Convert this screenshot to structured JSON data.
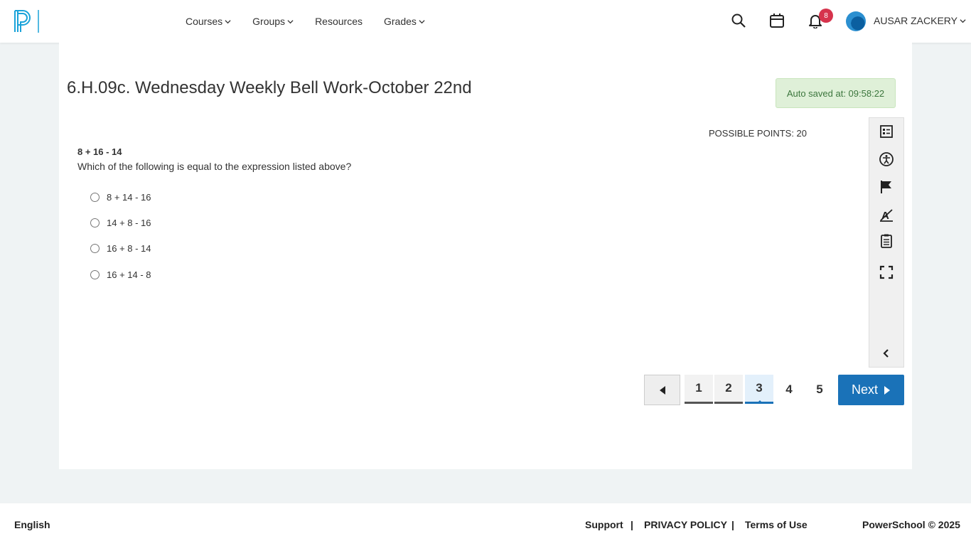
{
  "header": {
    "nav": [
      {
        "label": "Courses",
        "has_dropdown": true
      },
      {
        "label": "Groups",
        "has_dropdown": true
      },
      {
        "label": "Resources",
        "has_dropdown": false
      },
      {
        "label": "Grades",
        "has_dropdown": true
      }
    ],
    "icons": [
      "search-icon",
      "calendar-icon",
      "bell-icon"
    ],
    "notification_count": "8",
    "user_name": "AUSAR ZACKERY"
  },
  "assessment": {
    "title": "6.H.09c. Wednesday Weekly Bell Work-October 22nd",
    "autosave": "Auto saved at: 09:58:22",
    "possible_points": "POSSIBLE POINTS: 20",
    "question_expression": "8 + 16 - 14",
    "question_text": "Which of the following is equal to the expression listed above?",
    "options": [
      "8 + 14 - 16",
      "14 + 8 - 16",
      "16 + 8 - 14",
      "16 + 14 - 8"
    ]
  },
  "toolbar": {
    "tools": [
      "question-list-icon",
      "accessibility-icon",
      "flag-icon",
      "eliminator-icon",
      "notepad-icon",
      "fullscreen-icon",
      "collapse-chevron-icon"
    ]
  },
  "pagination": {
    "pages": [
      "1",
      "2",
      "3",
      "4",
      "5"
    ],
    "current_page": "3",
    "next_label": "Next"
  },
  "footer": {
    "language": "English",
    "support": "Support",
    "separator": "|",
    "privacy": "PRIVACY POLICY",
    "terms": "Terms of Use",
    "copyright": "PowerSchool © 2025"
  },
  "colors": {
    "accent": "#1a72b8",
    "badge": "#d6334c",
    "autosave_bg": "#dff0d8",
    "autosave_text": "#3c763d"
  }
}
